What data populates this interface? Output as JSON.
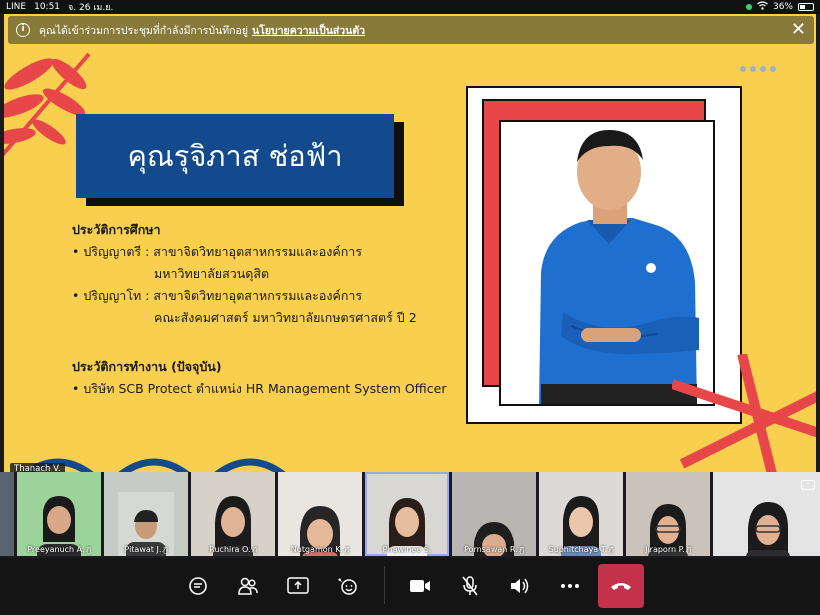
{
  "status_bar": {
    "carrier": "LINE",
    "time": "10:51",
    "date": "จ. 26 เม.ย.",
    "battery": "36%"
  },
  "banner": {
    "message": "คุณได้เข้าร่วมการประชุมที่กำลังมีการบันทึกอยู่",
    "link": "นโยบายความเป็นส่วนตัว",
    "icon": "info-icon"
  },
  "slide": {
    "name": "คุณรุจิภาส ช่อฟ้า",
    "education": {
      "title": "ประวัติการศึกษา",
      "bachelor_line1": "• ปริญญาตรี : สาขาจิตวิทยาอุตสาหกรรมและองค์การ",
      "bachelor_line2": "มหาวิทยาลัยสวนดุสิต",
      "master_line1": "• ปริญญาโท : สาขาจิตวิทยาอุตสาหกรรมและองค์การ",
      "master_line2": "คณะสังคมศาสตร์ มหาวิทยาลัยเกษตรศาสตร์ ปี 2"
    },
    "work": {
      "title": "ประวัติการทำงาน (ปัจจุบัน)",
      "line1": "• บริษัท SCB Protect  ตำแหน่ง HR Management System Officer"
    },
    "presenter_tag": "Thanach V."
  },
  "participants": [
    {
      "name": "Preeyanuch A.",
      "muted": true
    },
    {
      "name": "Pitawat J.",
      "muted": true
    },
    {
      "name": "Ruchira O.",
      "muted": true
    },
    {
      "name": "Nutgamon K.",
      "muted": true
    },
    {
      "name": "Phawinee S.",
      "muted": false,
      "active": true
    },
    {
      "name": "Pornsawan R.",
      "muted": true
    },
    {
      "name": "Suphitchaya T.",
      "muted": true
    },
    {
      "name": "Jiraporn P.",
      "muted": true
    }
  ],
  "controls": [
    "chat-icon",
    "people-icon",
    "share-screen-icon",
    "reactions-icon",
    "camera-icon",
    "microphone-muted-icon",
    "speaker-icon",
    "more-icon",
    "end-call-icon"
  ],
  "colors": {
    "slide_bg": "#f8cf4f",
    "name_box": "#134a8e",
    "accent_red": "#e8474a",
    "banner": "#8a7a3a",
    "end_call": "#c4314b"
  }
}
